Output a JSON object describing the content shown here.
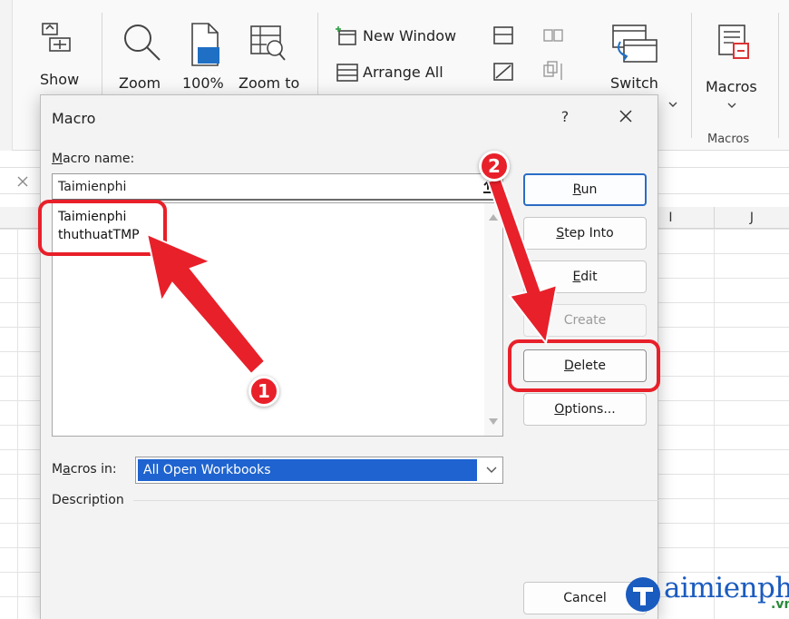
{
  "ribbon": {
    "show_label": "Show",
    "zoom_label": "Zoom",
    "zoom100_label": "100%",
    "zoom100_icon_text": "100",
    "zoom_to_label": "Zoom to",
    "new_window_label": "New Window",
    "arrange_all_label": "Arrange All",
    "switch_label": "Switch",
    "macros_label": "Macros",
    "macros_group_label": "Macros"
  },
  "sheet": {
    "columns": [
      "I",
      "J"
    ]
  },
  "dialog": {
    "title": "Macro",
    "help_label": "?",
    "macro_name_label": "Macro name:",
    "macro_name_value": "Taimienphi",
    "macros": [
      "Taimienphi",
      "thuthuatTMP"
    ],
    "buttons": {
      "run": "Run",
      "step_into": "Step Into",
      "edit": "Edit",
      "create": "Create",
      "delete": "Delete",
      "options": "Options...",
      "cancel": "Cancel"
    },
    "macros_in_label": "Macros in:",
    "macros_in_value": "All Open Workbooks",
    "description_label": "Description"
  },
  "annotations": {
    "badge1": "1",
    "badge2": "2",
    "color": "#e8202a"
  },
  "watermark": {
    "text": "aimienphi",
    "suffix": ".vn",
    "brand_color": "#1a5bbf"
  }
}
